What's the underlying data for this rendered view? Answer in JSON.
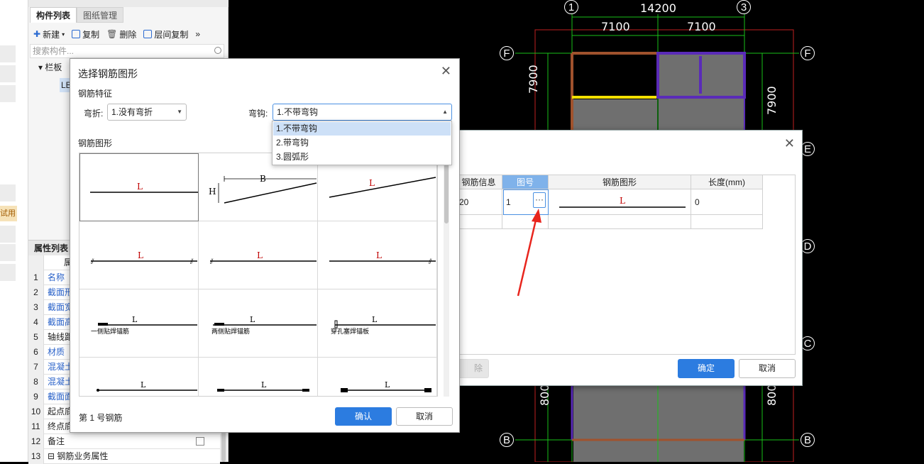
{
  "left_panel": {
    "trial_tag": "试用",
    "tabs": [
      "构件列表",
      "图纸管理"
    ],
    "toolbar": {
      "new": "新建",
      "copy": "复制",
      "delete": "删除",
      "floor_copy": "层间复制",
      "more": "»"
    },
    "search_placeholder": "搜索构件...",
    "tree": {
      "root": "栏板",
      "child": "LB"
    },
    "properties": {
      "header": "属性列表",
      "col_header": "属",
      "rows": [
        {
          "n": "1",
          "name": "名称",
          "blue": true
        },
        {
          "n": "2",
          "name": "截面形",
          "blue": true
        },
        {
          "n": "3",
          "name": "截面宽",
          "blue": true
        },
        {
          "n": "4",
          "name": "截面高",
          "blue": true
        },
        {
          "n": "5",
          "name": "轴线距",
          "blue": false
        },
        {
          "n": "6",
          "name": "材质",
          "blue": true
        },
        {
          "n": "7",
          "name": "混凝土",
          "blue": true
        },
        {
          "n": "8",
          "name": "混凝土",
          "blue": true
        },
        {
          "n": "9",
          "name": "截面面",
          "blue": true
        },
        {
          "n": "10",
          "name": "起点底",
          "blue": false
        },
        {
          "n": "11",
          "name": "终点底",
          "blue": false
        },
        {
          "n": "12",
          "name": "备注",
          "blue": false
        },
        {
          "n": "13",
          "name": "⊟ 钢筋业务属性",
          "blue": false
        }
      ]
    }
  },
  "cad": {
    "axis_top": [
      "1",
      "3"
    ],
    "total_dim": "14200",
    "dims_top": [
      "7100",
      "7100"
    ],
    "axis_right": [
      "F",
      "E",
      "D",
      "C",
      "B"
    ],
    "axis_left": [
      "F",
      "B"
    ],
    "dim_side": "7900",
    "dim_side_bottom": "800",
    "colors": {
      "line": "#19c119",
      "red_line": "#c02020",
      "brown": "#a0522d",
      "purple": "#5a2bb8",
      "yellow": "#f2e000",
      "fill": "#6f6f6f"
    }
  },
  "dialog_back": {
    "table_headers": [
      "钢筋信息",
      "图号",
      "钢筋图形",
      "长度(mm)"
    ],
    "row": {
      "info": "20",
      "figure_no": "1",
      "shape_label": "L",
      "length": "0"
    },
    "figure_btn": "···",
    "delete_btn": "除",
    "ok": "确定",
    "cancel": "取消"
  },
  "dialog_front": {
    "title": "选择钢筋图形",
    "feature_label": "钢筋特征",
    "bend_label": "弯折:",
    "bend_value": "1.没有弯折",
    "hook_label": "弯钩:",
    "hook_value": "1.不带弯钩",
    "hook_options": [
      "1.不带弯钩",
      "2.带弯钩",
      "3.圆弧形"
    ],
    "shape_label": "钢筋图形",
    "shapes": [
      {
        "L": "L"
      },
      {
        "B": "B",
        "H": "H"
      },
      {
        "L": "L"
      },
      {
        "L": "L"
      },
      {
        "L": "L"
      },
      {
        "L": "L"
      },
      {
        "L": "L",
        "note": "一侧贴焊锚筋"
      },
      {
        "L": "L",
        "note": "两侧贴焊锚筋"
      },
      {
        "L": "L",
        "note": "穿孔塞焊锚板"
      },
      {
        "L": "L"
      },
      {
        "L": "L"
      },
      {
        "L": "L"
      }
    ],
    "status": "第 1 号钢筋",
    "ok": "确认",
    "cancel": "取消"
  }
}
